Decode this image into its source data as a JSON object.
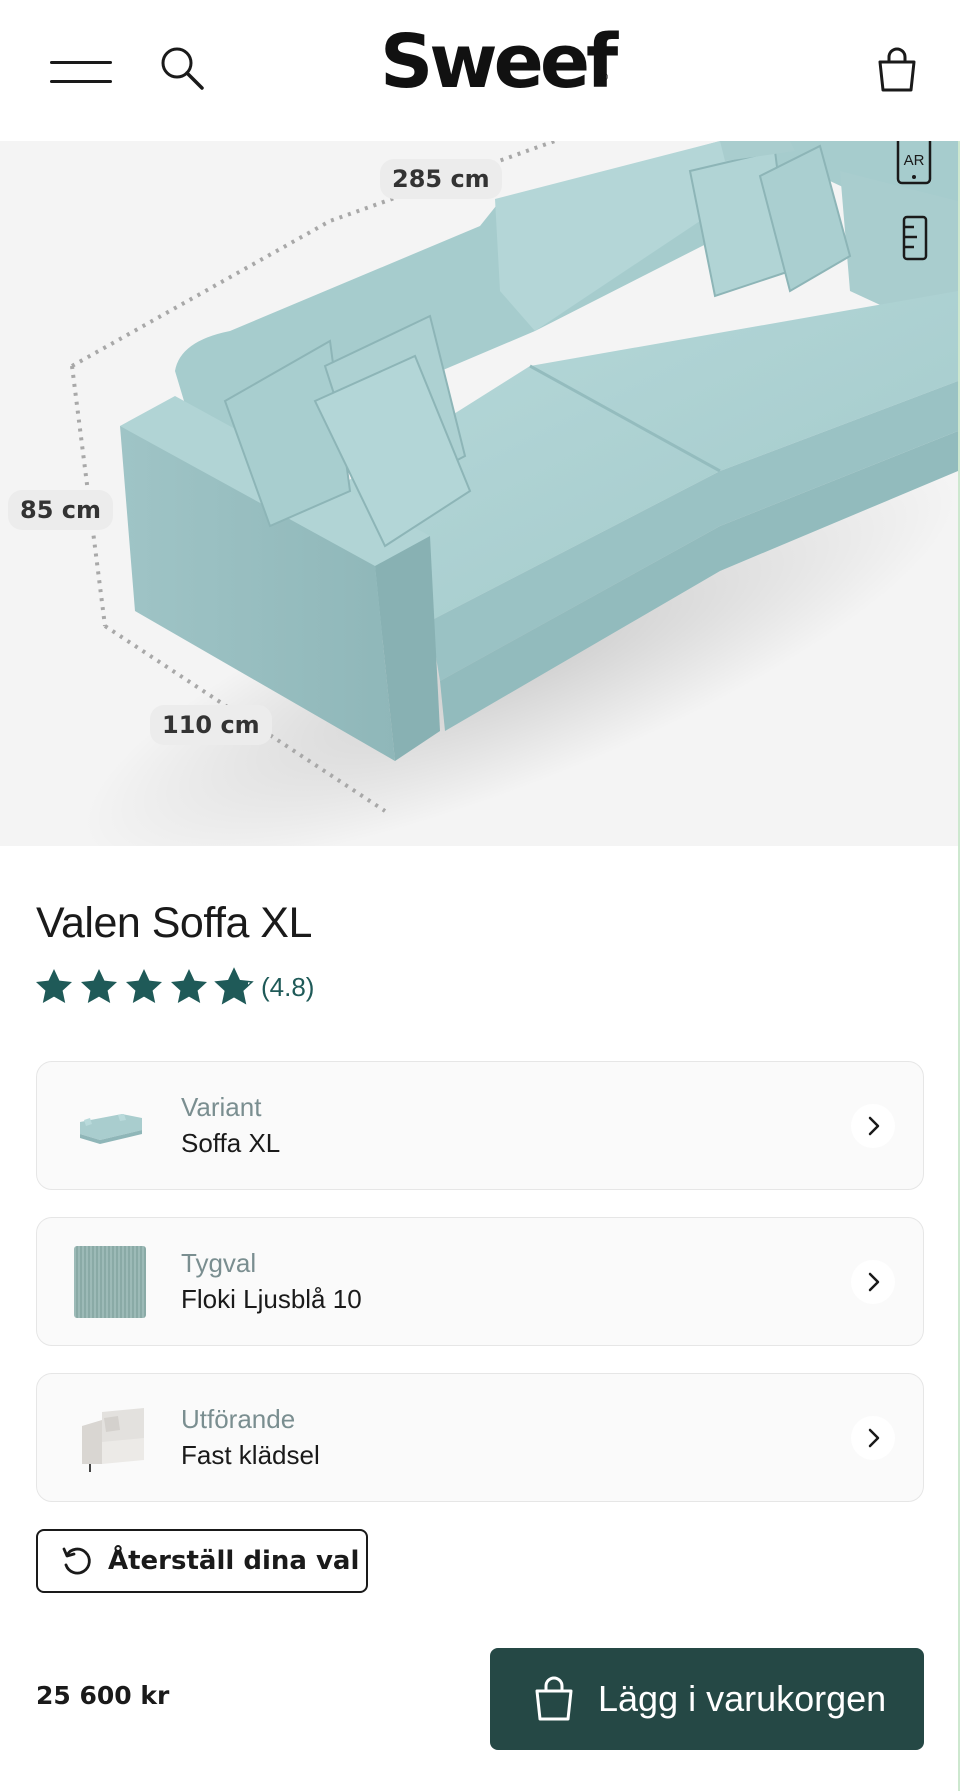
{
  "header": {
    "logo_text": "Sweef",
    "logo_mark": "®",
    "icons": {
      "menu": "hamburger-menu-icon",
      "search": "search-icon",
      "cart": "shopping-bag-icon"
    }
  },
  "hero": {
    "dimensions": {
      "width": "285 cm",
      "height": "85 cm",
      "depth": "110 cm"
    },
    "ar_label": "AR",
    "icons": {
      "ar": "ar-phone-icon",
      "measure": "ruler-icon"
    }
  },
  "product": {
    "name": "Valen Soffa XL",
    "rating_text": "(4.8)",
    "rating_value": 4.8,
    "rating_max": 5
  },
  "options": [
    {
      "label": "Variant",
      "value": "Soffa XL",
      "thumb": "sofa-thumbnail"
    },
    {
      "label": "Tygval",
      "value": "Floki Ljusblå 10",
      "thumb": "fabric-swatch"
    },
    {
      "label": "Utförande",
      "value": "Fast klädsel",
      "thumb": "armchair-thumbnail"
    }
  ],
  "reset": {
    "label": "Återställ dina val",
    "icon": "reset-arrow-icon"
  },
  "purchase": {
    "price": "25 600 kr",
    "button_label": "Lägg i varukorgen",
    "icon": "shopping-bag-icon"
  },
  "colors": {
    "accent": "#254845",
    "star": "#1f5a58",
    "hero_bg": "#f4f4f4",
    "sofa": "#a9cfd0"
  }
}
